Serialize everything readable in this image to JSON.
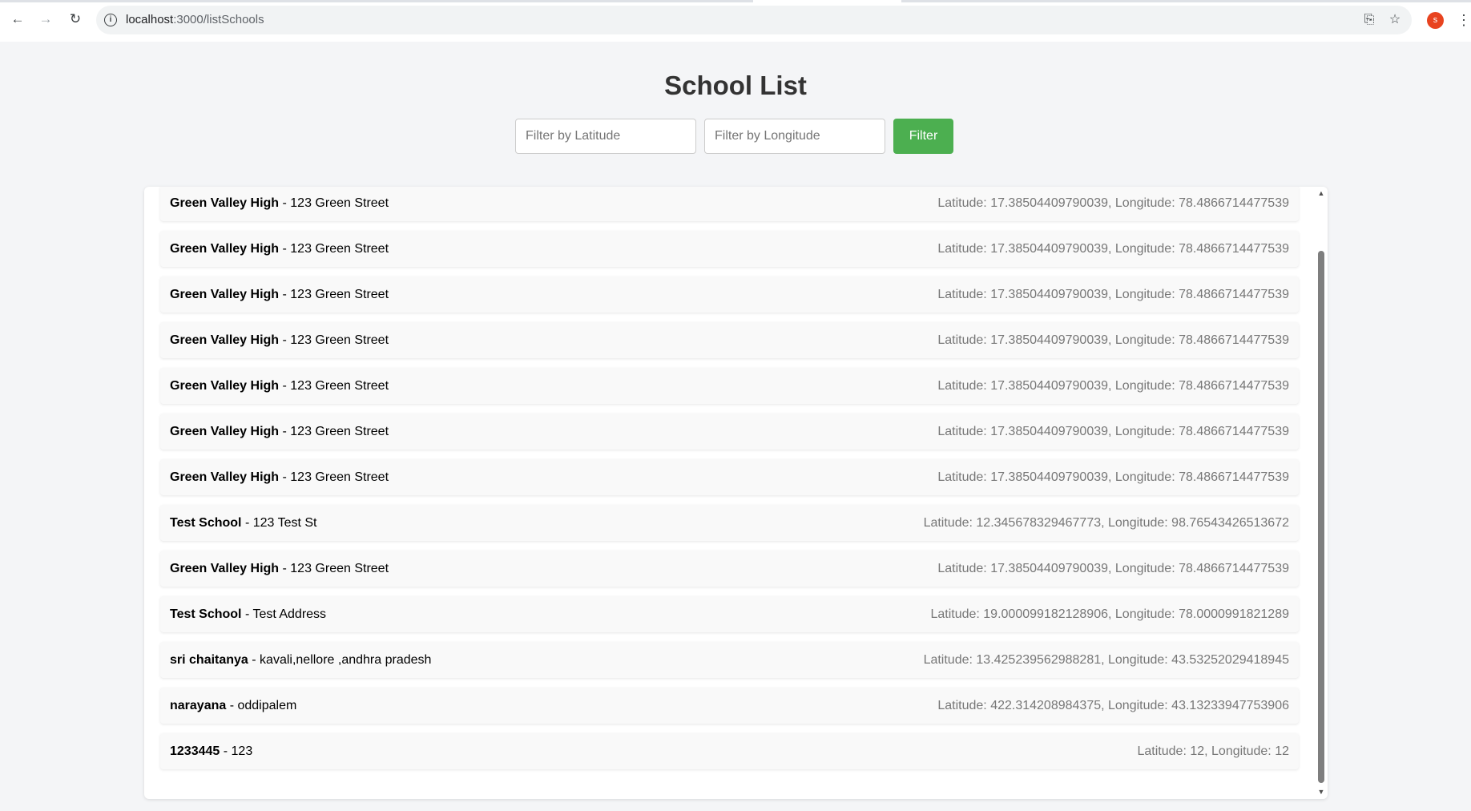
{
  "browser": {
    "url_host": "localhost",
    "url_path": ":3000/listSchools",
    "profile_initial": "s"
  },
  "page": {
    "title": "School List",
    "filter": {
      "latitude_placeholder": "Filter by Latitude",
      "longitude_placeholder": "Filter by Longitude",
      "button_label": "Filter",
      "button_color": "#4caf50"
    }
  },
  "schools": [
    {
      "name": "Green Valley High",
      "sep": " - ",
      "address": "123 Green Street",
      "coords": "Latitude: 17.38504409790039, Longitude: 78.4866714477539"
    },
    {
      "name": "Green Valley High",
      "sep": " - ",
      "address": "123 Green Street",
      "coords": "Latitude: 17.38504409790039, Longitude: 78.4866714477539"
    },
    {
      "name": "Green Valley High",
      "sep": " - ",
      "address": "123 Green Street",
      "coords": "Latitude: 17.38504409790039, Longitude: 78.4866714477539"
    },
    {
      "name": "Green Valley High",
      "sep": " - ",
      "address": "123 Green Street",
      "coords": "Latitude: 17.38504409790039, Longitude: 78.4866714477539"
    },
    {
      "name": "Green Valley High",
      "sep": " - ",
      "address": "123 Green Street",
      "coords": "Latitude: 17.38504409790039, Longitude: 78.4866714477539"
    },
    {
      "name": "Green Valley High",
      "sep": " - ",
      "address": "123 Green Street",
      "coords": "Latitude: 17.38504409790039, Longitude: 78.4866714477539"
    },
    {
      "name": "Green Valley High",
      "sep": " - ",
      "address": "123 Green Street",
      "coords": "Latitude: 17.38504409790039, Longitude: 78.4866714477539"
    },
    {
      "name": "Test School",
      "sep": " - ",
      "address": "123 Test St",
      "coords": "Latitude: 12.345678329467773, Longitude: 98.76543426513672"
    },
    {
      "name": "Green Valley High",
      "sep": " - ",
      "address": "123 Green Street",
      "coords": "Latitude: 17.38504409790039, Longitude: 78.4866714477539"
    },
    {
      "name": "Test School",
      "sep": " - ",
      "address": "Test Address",
      "coords": "Latitude: 19.000099182128906, Longitude: 78.0000991821289"
    },
    {
      "name": "sri chaitanya",
      "sep": " - ",
      "address": "kavali,nellore ,andhra pradesh",
      "coords": "Latitude: 13.425239562988281, Longitude: 43.53252029418945"
    },
    {
      "name": "narayana",
      "sep": " - ",
      "address": "oddipalem",
      "coords": "Latitude: 422.314208984375, Longitude: 43.13233947753906"
    },
    {
      "name": "1233445",
      "sep": " - ",
      "address": "123",
      "coords": "Latitude: 12, Longitude: 12"
    }
  ]
}
